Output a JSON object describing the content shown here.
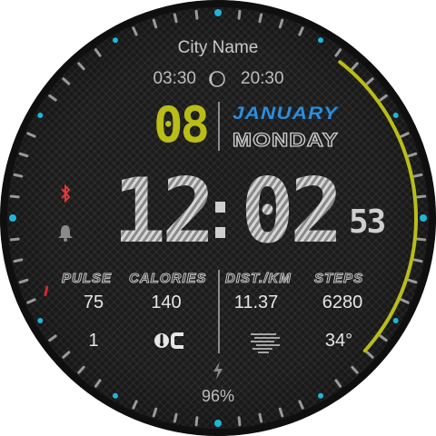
{
  "watchface": {
    "city": "City Name",
    "sunrise": "03:30",
    "sunset": "20:30",
    "date": {
      "day": "08",
      "month": "JANUARY",
      "weekday": "MONDAY"
    },
    "time": {
      "hours": "12",
      "minutes": "02",
      "seconds": "53"
    },
    "stats": {
      "pulse": {
        "label": "PULSE",
        "value": "75"
      },
      "calories": {
        "label": "CALORIES",
        "value": "140"
      },
      "distance": {
        "label": "DIST./KM",
        "value": "11.37"
      },
      "steps": {
        "label": "STEPS",
        "value": "6280"
      }
    },
    "second_row": {
      "left_value": "1",
      "temperature": "34°"
    },
    "battery": {
      "percent_text": "96%",
      "level": 0.96
    },
    "icons": [
      "moon-icon",
      "bluetooth-icon",
      "bell-icon",
      "thermometer-icon",
      "weather-icon",
      "lightning-icon"
    ],
    "colors": {
      "accent_yellow": "#b9bd16",
      "month_blue": "#2a8ee0",
      "marker_cyan": "#1fb6d8",
      "marker_red": "#d4282a",
      "bluetooth_red": "#e23a3a"
    }
  }
}
